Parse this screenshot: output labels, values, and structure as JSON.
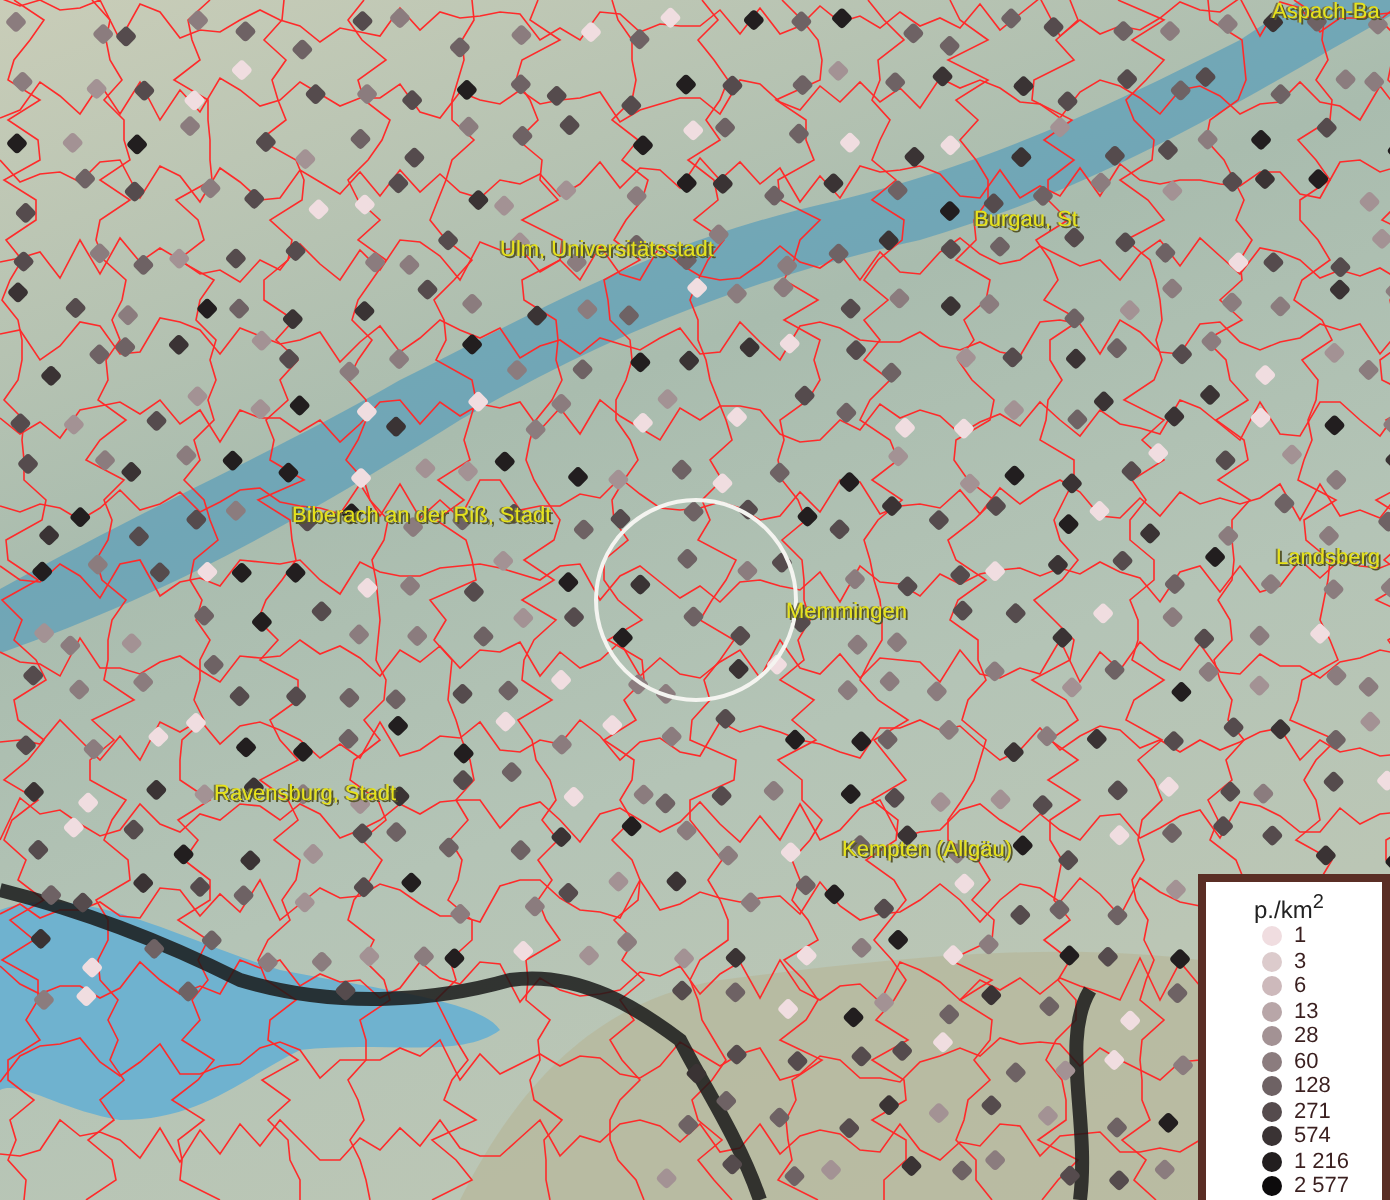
{
  "map": {
    "places": [
      {
        "name": "Aspach-Ba"
      },
      {
        "name": "Burgau, St"
      },
      {
        "name": "Ulm, Universitätsstadt"
      },
      {
        "name": "Biberach an der Riß, Stadt"
      },
      {
        "name": "Landsberg"
      },
      {
        "name": "Memmingen"
      },
      {
        "name": "Ravensburg, Stadt"
      },
      {
        "name": "Kempten (Allgäu)"
      }
    ]
  },
  "legend": {
    "title": "p./km$^{2}$",
    "items": [
      {
        "label": "1",
        "color": "#f0dde0"
      },
      {
        "label": "3",
        "color": "#dccbcc"
      },
      {
        "label": "6",
        "color": "#cdb9bb"
      },
      {
        "label": "13",
        "color": "#b8a6a8"
      },
      {
        "label": "28",
        "color": "#a39294"
      },
      {
        "label": "60",
        "color": "#8b7c7e"
      },
      {
        "label": "128",
        "color": "#6e6264"
      },
      {
        "label": "271",
        "color": "#554b4d"
      },
      {
        "label": "574",
        "color": "#3a3334"
      },
      {
        "label": "1 216",
        "color": "#221e1f"
      },
      {
        "label": "2 577",
        "color": "#0d0b0c"
      }
    ]
  }
}
